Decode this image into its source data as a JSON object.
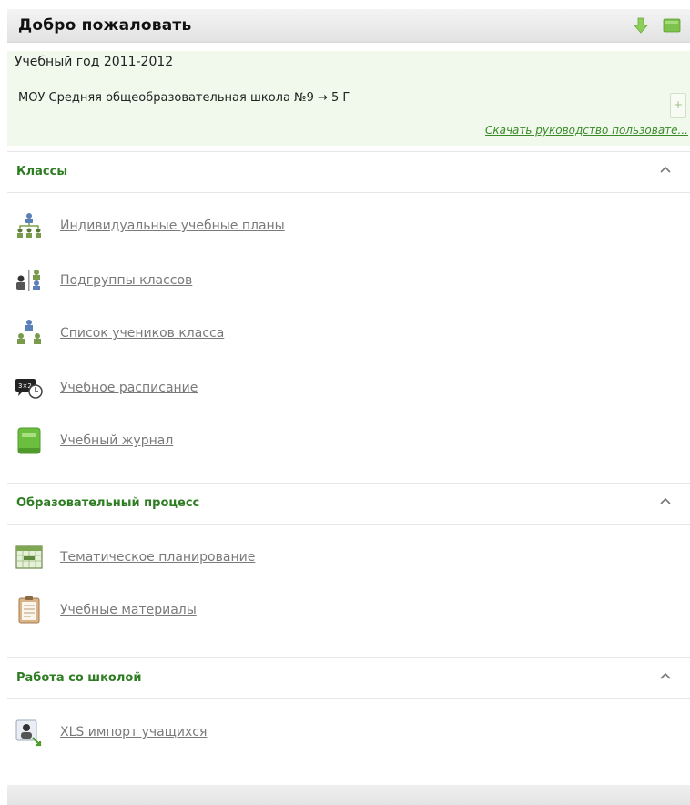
{
  "header": {
    "title": "Добро пожаловать"
  },
  "info": {
    "school_year": "Учебный год 2011-2012",
    "school_path": "МОУ Средняя общеобразовательная школа №9 → 5 Г",
    "plus_symbol": "+",
    "manual_link": "Скачать руководство пользовате..."
  },
  "sections": [
    {
      "title": "Классы",
      "items": [
        {
          "label": "Индивидуальные учебные планы",
          "icon": "org-chart-icon"
        },
        {
          "label": "Подгруппы классов",
          "icon": "subgroups-icon"
        },
        {
          "label": "Список учеников класса",
          "icon": "students-list-icon"
        },
        {
          "label": "Учебное расписание",
          "icon": "schedule-clock-icon"
        },
        {
          "label": "Учебный журнал",
          "icon": "green-journal-icon"
        }
      ]
    },
    {
      "title": "Образовательный процесс",
      "items": [
        {
          "label": "Тематическое планирование",
          "icon": "calendar-plan-icon"
        },
        {
          "label": "Учебные материалы",
          "icon": "notepad-icon"
        }
      ]
    },
    {
      "title": "Работа со школой",
      "items": [
        {
          "label": "XLS импорт учащихся",
          "icon": "user-import-icon"
        }
      ]
    }
  ],
  "colors": {
    "accent_green": "#2f7d23",
    "link_gray": "#7a7a7a",
    "info_bg": "#f1f9ec"
  }
}
